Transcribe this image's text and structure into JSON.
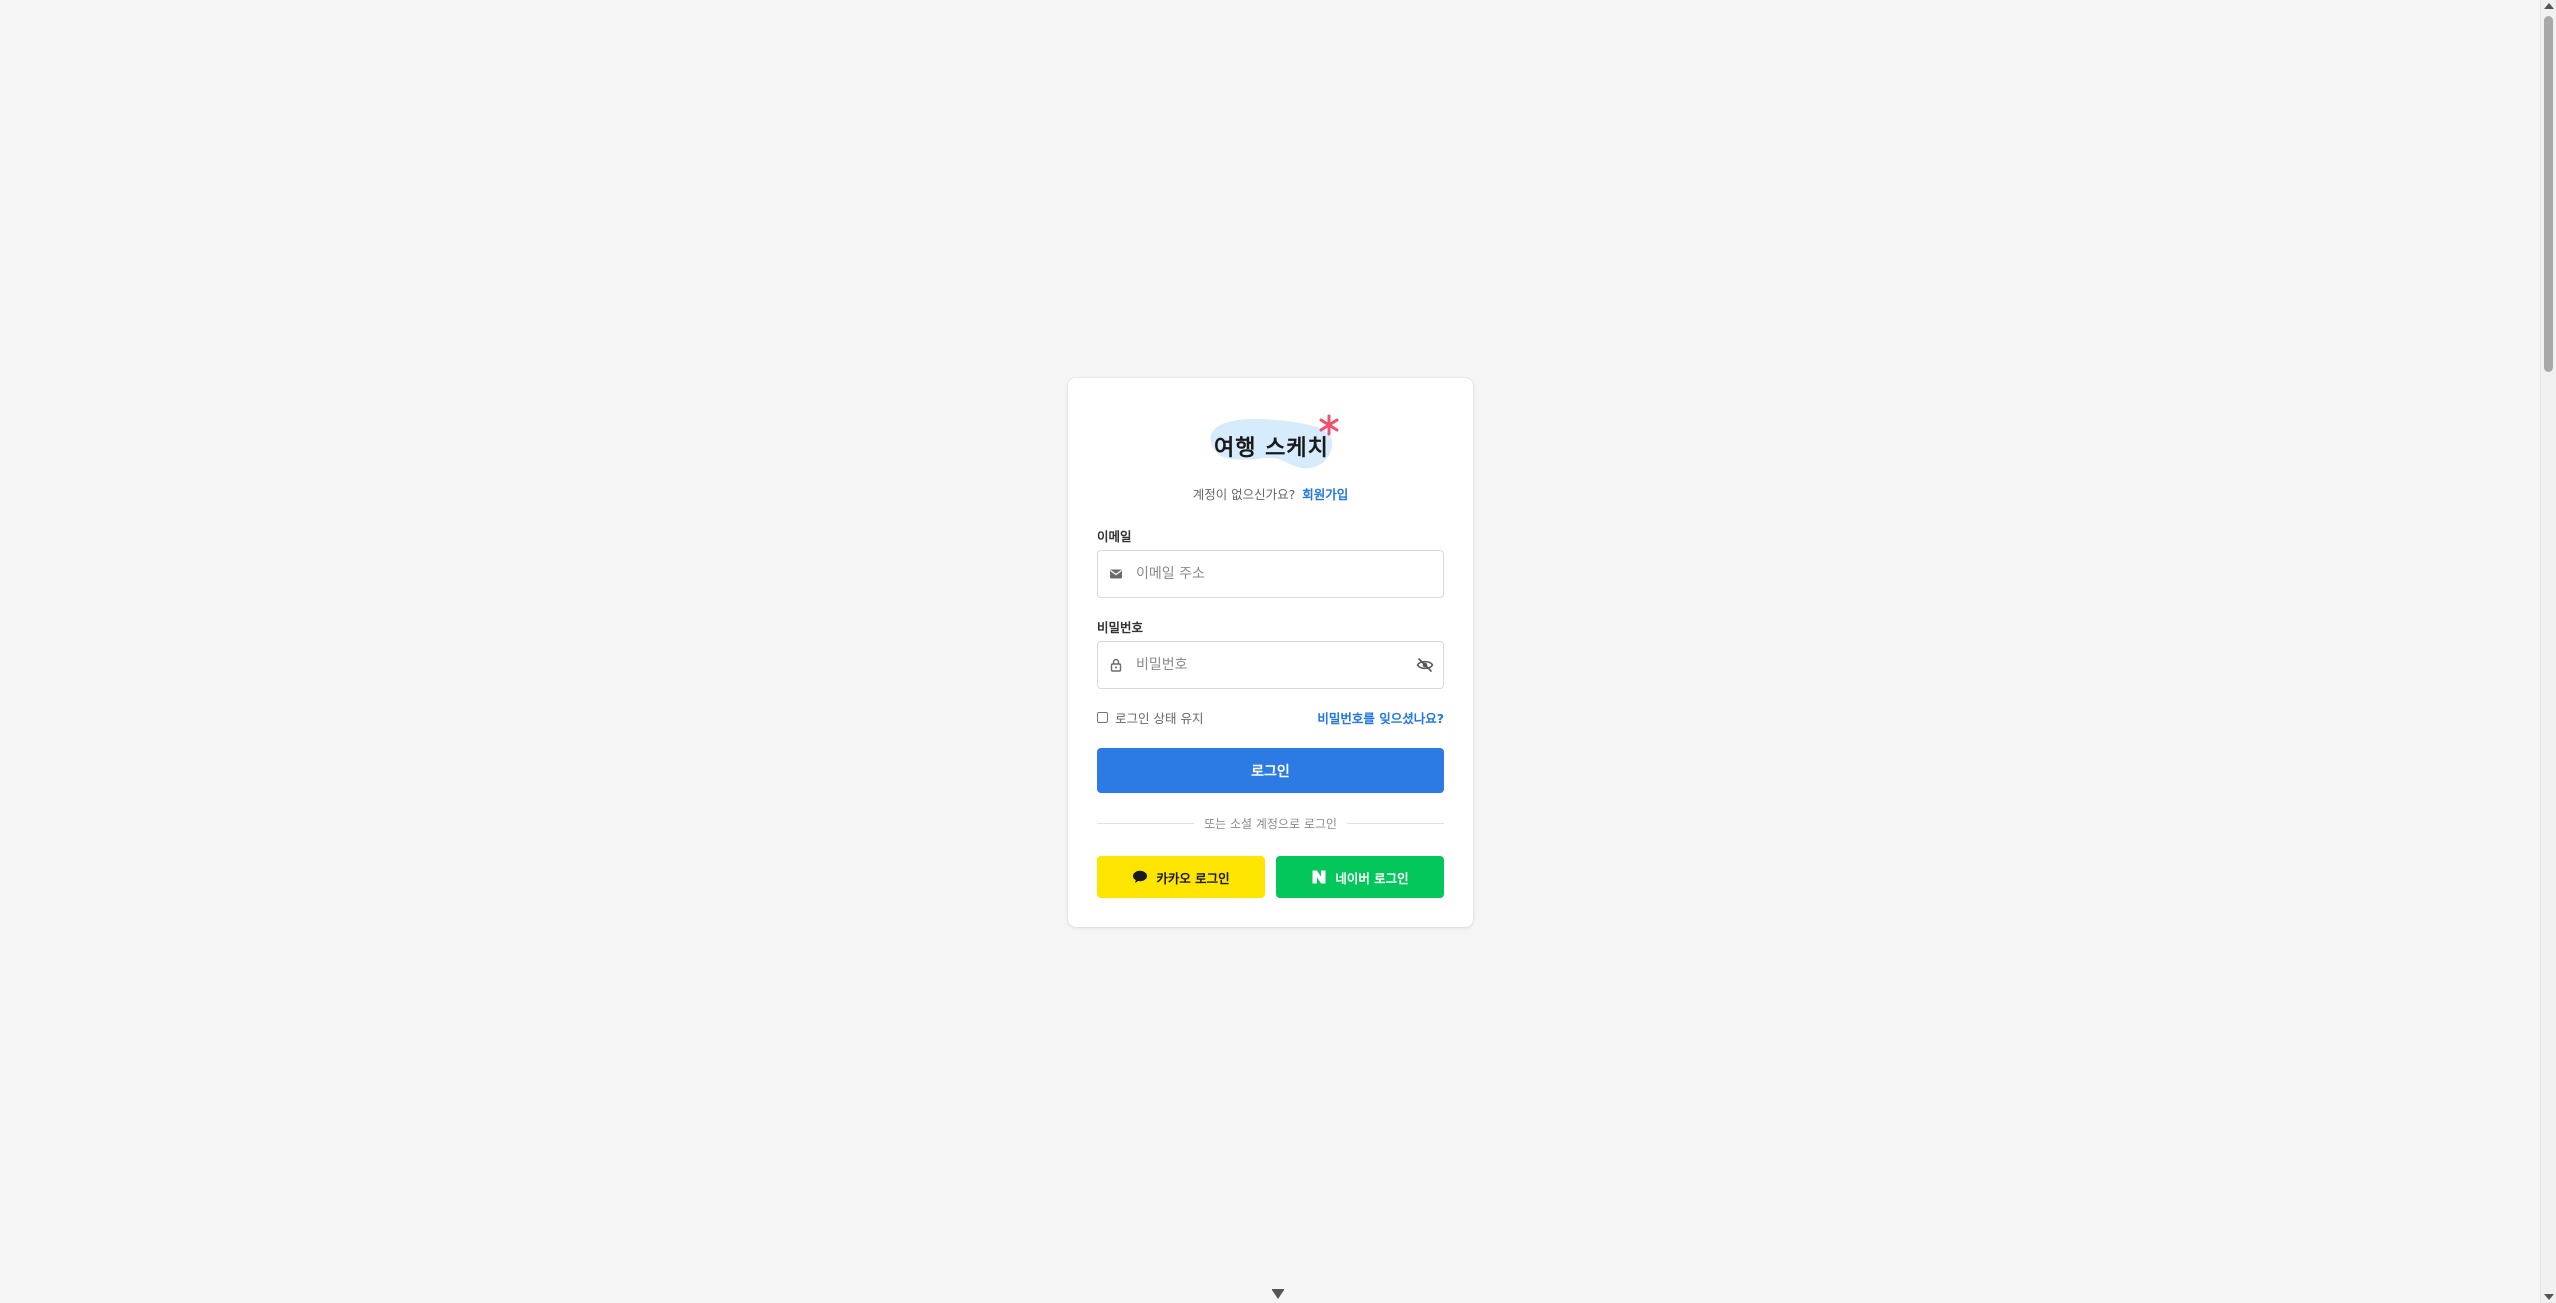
{
  "logo": {
    "text": "여행 스케치",
    "accent_color": "#f0506e",
    "blob_color": "#d6ebfb"
  },
  "signup": {
    "prompt": "계정이 없으신가요?",
    "link": "회원가입"
  },
  "email": {
    "label": "이메일",
    "placeholder": "이메일 주소",
    "value": "",
    "icon": "mail-icon"
  },
  "password": {
    "label": "비밀번호",
    "placeholder": "비밀번호",
    "value": "",
    "icon": "lock-icon",
    "toggle_icon": "eye-off-icon"
  },
  "remember": {
    "label": "로그인 상태 유지",
    "checked": false
  },
  "forgot": {
    "label": "비밀번호를 잊으셨나요?"
  },
  "login_button": {
    "label": "로그인",
    "color": "#2c7be5"
  },
  "divider": {
    "text": "또는 소셜 계정으로 로그인"
  },
  "social": {
    "kakao": {
      "label": "카카오 로그인",
      "icon": "speech-bubble-icon",
      "color": "#fee500"
    },
    "naver": {
      "label": "네이버 로그인",
      "icon": "naver-n-icon",
      "color": "#03c75a"
    }
  },
  "colors": {
    "background": "#f5f5f5",
    "link": "#2176e8"
  }
}
